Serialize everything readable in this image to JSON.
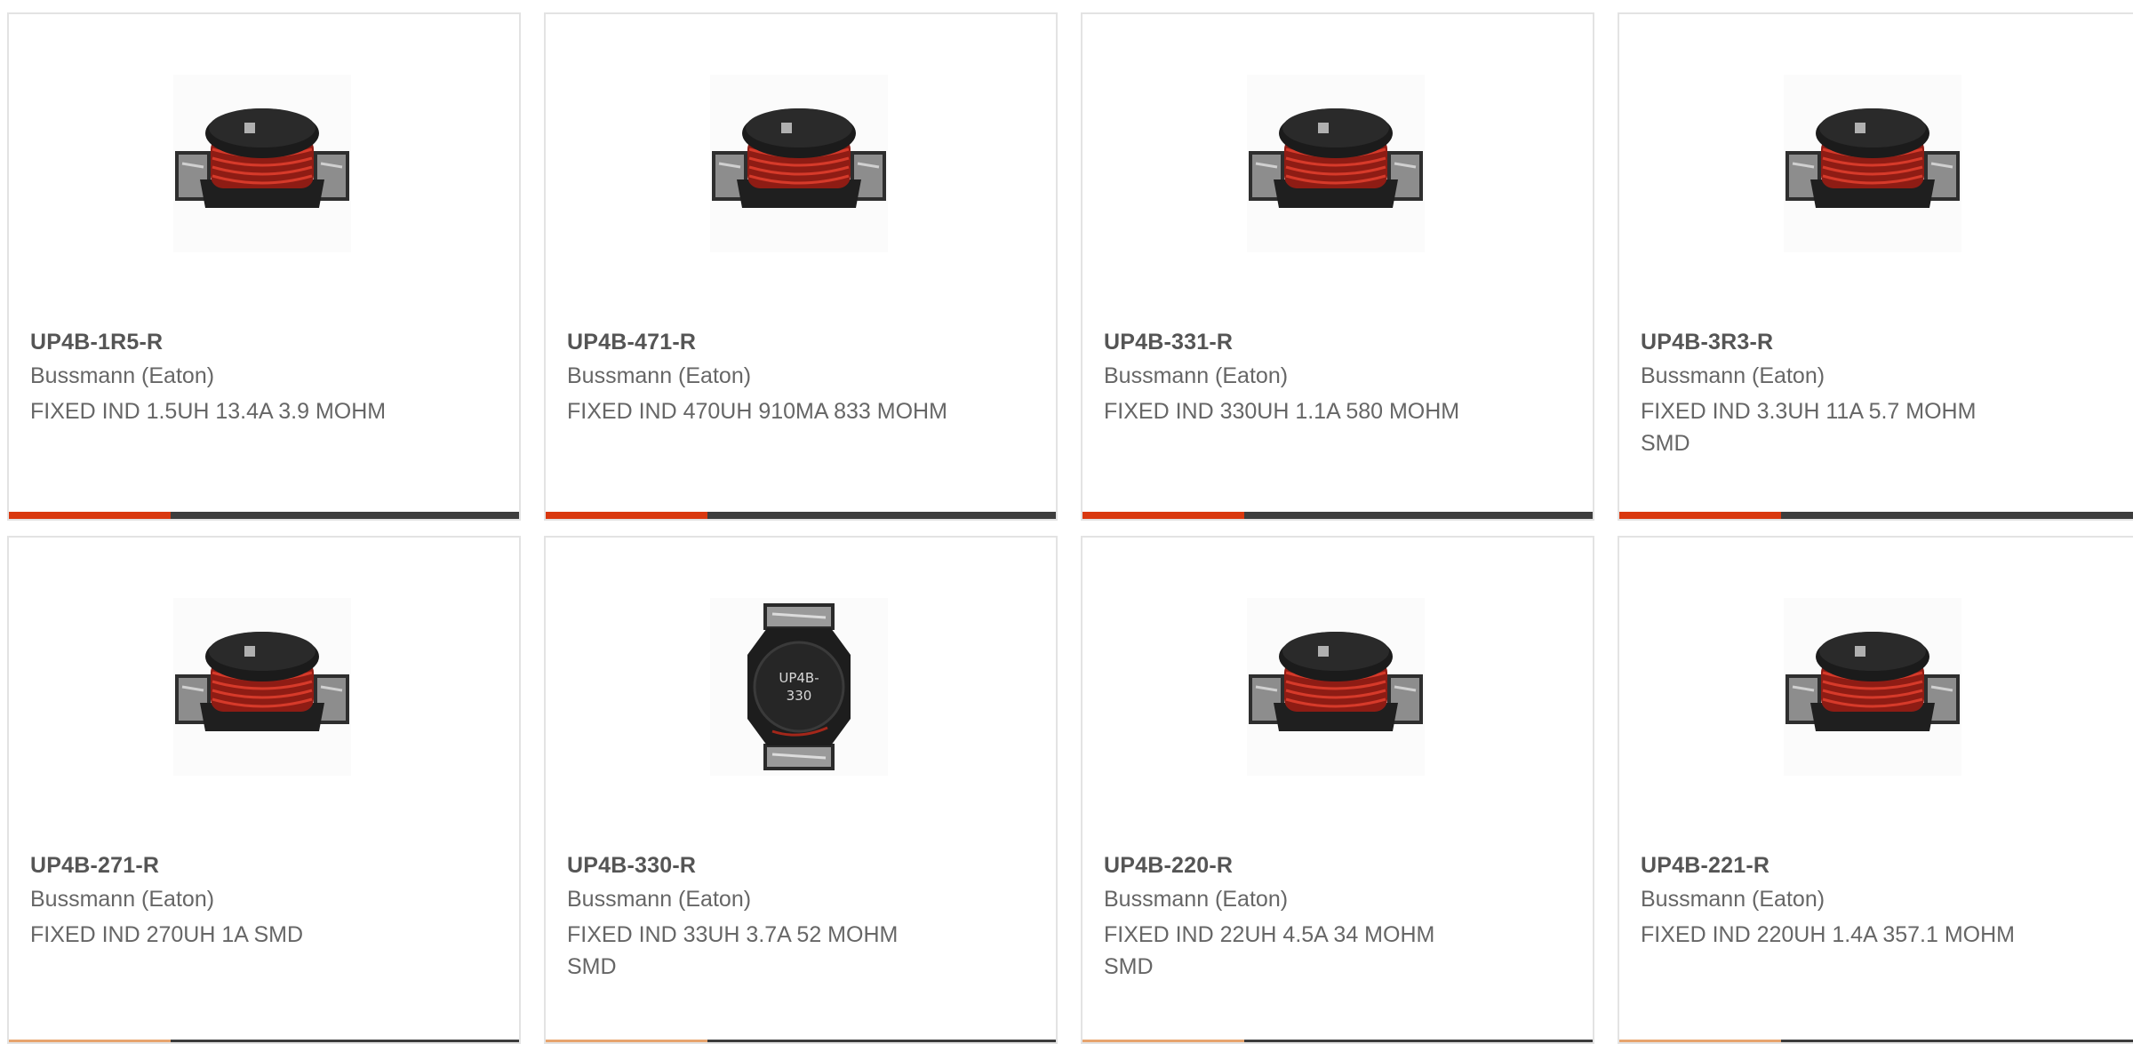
{
  "products": [
    {
      "part": "UP4B-1R5-R",
      "manufacturer": "Bussmann (Eaton)",
      "description": "FIXED IND 1.5UH 13.4A 3.9 MOHM",
      "image": "inductor-side-icon"
    },
    {
      "part": "UP4B-471-R",
      "manufacturer": "Bussmann (Eaton)",
      "description": "FIXED IND 470UH 910MA 833 MOHM",
      "image": "inductor-side-icon"
    },
    {
      "part": "UP4B-331-R",
      "manufacturer": "Bussmann (Eaton)",
      "description": "FIXED IND 330UH 1.1A 580 MOHM",
      "image": "inductor-side-icon"
    },
    {
      "part": "UP4B-3R3-R",
      "manufacturer": "Bussmann (Eaton)",
      "description": "FIXED IND 3.3UH 11A 5.7 MOHM SMD",
      "image": "inductor-side-icon"
    },
    {
      "part": "UP4B-271-R",
      "manufacturer": "Bussmann (Eaton)",
      "description": "FIXED IND 270UH 1A SMD",
      "image": "inductor-side-icon"
    },
    {
      "part": "UP4B-330-R",
      "manufacturer": "Bussmann (Eaton)",
      "description": "FIXED IND 33UH 3.7A 52 MOHM SMD",
      "image": "inductor-top-icon",
      "marking": [
        "UP4B-",
        "330"
      ]
    },
    {
      "part": "UP4B-220-R",
      "manufacturer": "Bussmann (Eaton)",
      "description": "FIXED IND 22UH 4.5A 34 MOHM SMD",
      "image": "inductor-side-icon"
    },
    {
      "part": "UP4B-221-R",
      "manufacturer": "Bussmann (Eaton)",
      "description": "FIXED IND 220UH 1.4A 357.1 MOHM",
      "image": "inductor-side-icon"
    }
  ],
  "colors": {
    "accent": "#d9380f",
    "bar": "#3d3d3d",
    "border": "#e3e3e3",
    "text": "#666666"
  }
}
